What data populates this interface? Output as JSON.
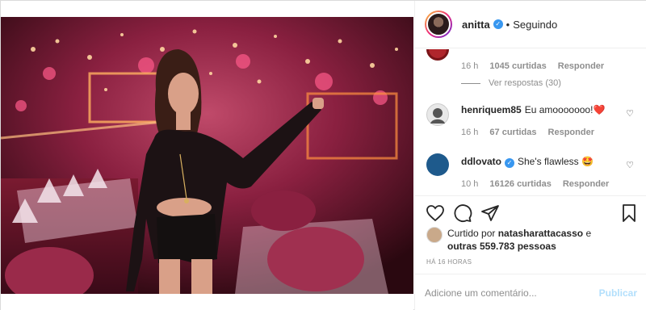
{
  "post": {
    "username": "anitta",
    "follow_status": "Seguindo",
    "separator": "•"
  },
  "comments": [
    {
      "time": "16 h",
      "likes": "1045 curtidas",
      "reply": "Responder",
      "view_replies": "Ver respostas (30)"
    },
    {
      "username": "henriquem85",
      "text": "Eu amooooooo!",
      "emoji": "❤️",
      "time": "16 h",
      "likes": "67 curtidas",
      "reply": "Responder"
    },
    {
      "username": "ddlovato",
      "text": "She's flawless",
      "emoji": "🤩",
      "time": "10 h",
      "likes": "16126 curtidas",
      "reply": "Responder"
    }
  ],
  "likes": {
    "prefix": "Curtido por",
    "user": "natasharattacasso",
    "suffix": "e",
    "others": "outras 559.783 pessoas"
  },
  "timestamp": "HÁ 16 HORAS",
  "add_comment": {
    "placeholder": "Adicione um comentário...",
    "publish": "Publicar"
  },
  "colors": {
    "verified": "#3897f0",
    "publish_disabled": "#b2dffc",
    "muted": "#8e8e8e"
  },
  "icons": [
    "heart-icon",
    "comment-icon",
    "share-icon",
    "bookmark-icon",
    "verified-icon"
  ]
}
